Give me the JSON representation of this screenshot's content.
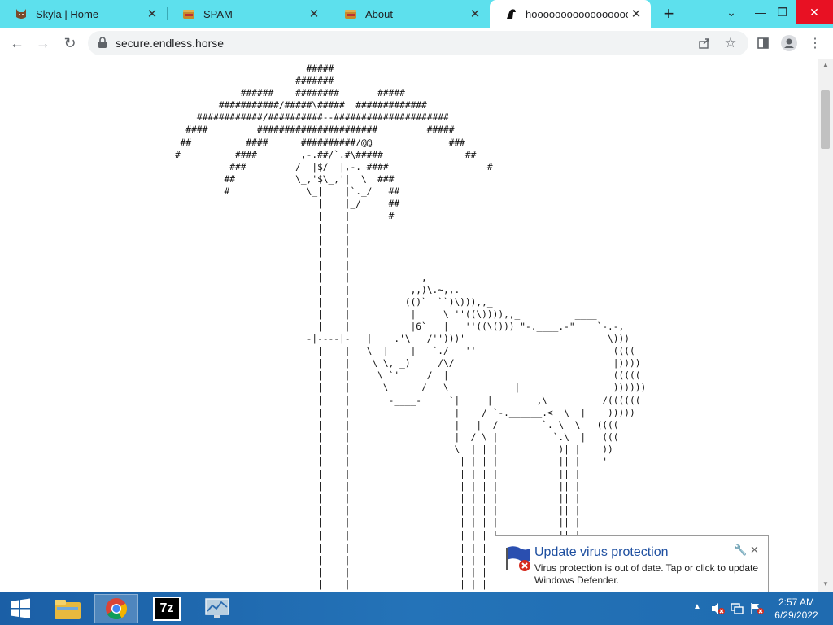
{
  "tabs": [
    {
      "title": "Skyla | Home",
      "favicon": "cat-icon",
      "active": false
    },
    {
      "title": "SPAM",
      "favicon": "spam-can-icon",
      "active": false
    },
    {
      "title": "About",
      "favicon": "spam-can-icon",
      "active": false
    },
    {
      "title": "hoooooooooooooooooo",
      "favicon": "horse-icon",
      "active": true
    }
  ],
  "new_tab_label": "+",
  "address_bar": {
    "url": "secure.endless.horse",
    "icon": "lock-icon"
  },
  "page": {
    "ascii_art": "                            #####\n                          #######\n                ######    ########       #####\n            ###########/#####\\#####  #############\n        ############/##########--#####################\n      ####         ######################         #####\n     ##          ####      ##########/@@              ###\n    #          ####        ,-.##/`.#\\#####               ##\n              ###         /  |$/  |,-. ####                  #\n             ##           \\_,'$\\_,'|  \\  ###\n             #              \\_|    |`._/   ##\n                              |    |_/     ##\n                              |    |       #\n                              |    |\n                              |    |\n                              |    |\n                              |    |\n                              |    |             ,\n                              |    |          _,,)\\.~,,._\n                              |    |          (()`  ``)\\))),,_\n                              |    |           |     \\ ''((\\)))),,_          ____\n                              |    |           |6`   |   ''((\\())) \"-.____.-\"    `-.-,\n                            -|----|-   |    .'\\   /'')))'                          \\)))\n                              |    |   \\  |    |   `./   ''                         ((((\n                              |    |    \\ \\, _)     /\\/                             |))))\n                              |    |     \\ `'     /  |                              (((((\n                              |    |      \\      /   \\            |                 ))))))\n                              |    |       -____-     `|     |        ,\\          /((((((\n                              |    |                   |    / `-.______.<  \\  |    )))))\n                              |    |                   |   |  /        `. \\  \\   ((((\n                              |    |                   |  / \\ |          `.\\  |   (((\n                              |    |                   \\  | | |           )| |    ))\n                              |    |                    | | | |           || |    '\n                              |    |                    | | | |           || |\n                              |    |                    | | | |           || |\n                              |    |                    | | | |           || |\n                              |    |                    | | | |           || |\n                              |    |                    | | | |           || |\n                              |    |                    | | | |           || |\n                              |    |                    | | | |           || |\n                              |    |                    | | | |           || |\n                              |    |                    | | | |           || |\n                              |    |                    | | | |           || |"
  },
  "notification": {
    "title": "Update virus protection",
    "body": "Virus protection is out of date. Tap or click to update Windows Defender.",
    "icon": "windows-defender-flag-icon"
  },
  "taskbar": {
    "apps": [
      {
        "name": "file-explorer",
        "icon": "folder-icon"
      },
      {
        "name": "chrome",
        "icon": "chrome-icon"
      },
      {
        "name": "7-zip",
        "icon": "7z-icon",
        "label": "7z"
      },
      {
        "name": "resource-monitor",
        "icon": "monitor-chart-icon"
      }
    ],
    "clock": {
      "time": "2:57 AM",
      "date": "6/29/2022"
    }
  },
  "colors": {
    "tabstrip": "#5de0ed",
    "taskbar": "#1f6bb0",
    "toast_title": "#1e4fa0"
  }
}
